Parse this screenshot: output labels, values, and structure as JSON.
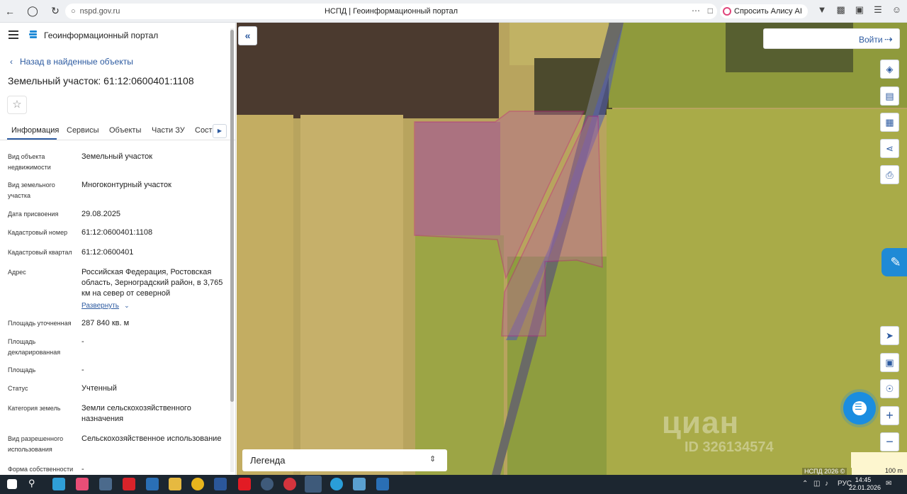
{
  "browser": {
    "url": "nspd.gov.ru",
    "page_title": "НСПД | Геоинформационный портал",
    "alice_label": "Спросить Алису AI"
  },
  "panel": {
    "portal_title": "Геоинформационный портал",
    "back_link": "Назад в найденные объекты",
    "object_title": "Земельный участок: 61:12:0600401:1108",
    "tabs": [
      "Информация",
      "Сервисы",
      "Объекты",
      "Части ЗУ",
      "Соста"
    ],
    "expand_label": "Развернуть",
    "fields": [
      {
        "label": "Вид объекта недвижимости",
        "value": "Земельный участок"
      },
      {
        "label": "Вид земельного участка",
        "value": "Многоконтурный участок"
      },
      {
        "label": "Дата присвоения",
        "value": "29.08.2025"
      },
      {
        "label": "Кадастровый номер",
        "value": "61:12:0600401:1108"
      },
      {
        "label": "Кадастровый квартал",
        "value": "61:12:0600401"
      },
      {
        "label": "Адрес",
        "value": "Российская Федерация, Ростовская область, Зерноградский район, в 3,765 км на север от северной"
      },
      {
        "label": "Площадь уточненная",
        "value": "287 840 кв. м"
      },
      {
        "label": "Площадь декларированная",
        "value": "-"
      },
      {
        "label": "Площадь",
        "value": "-"
      },
      {
        "label": "Статус",
        "value": "Учтенный"
      },
      {
        "label": "Категория земель",
        "value": "Земли сельскохозяйственного назначения"
      },
      {
        "label": "Вид разрешенного использования",
        "value": "Сельскохозяйственное использование"
      },
      {
        "label": "Форма собственности",
        "value": "-"
      }
    ]
  },
  "map": {
    "login_label": "Войти",
    "legend_label": "Легенда",
    "copyright": "НСПД 2026 ©",
    "scale_label": "100 m",
    "watermark": "циан",
    "watermark_id": "ID 326134574",
    "parcel_outline_color": "#c0208a"
  },
  "taskbar": {
    "lang": "РУС",
    "time": "14:45",
    "date": "22.01.2026"
  }
}
